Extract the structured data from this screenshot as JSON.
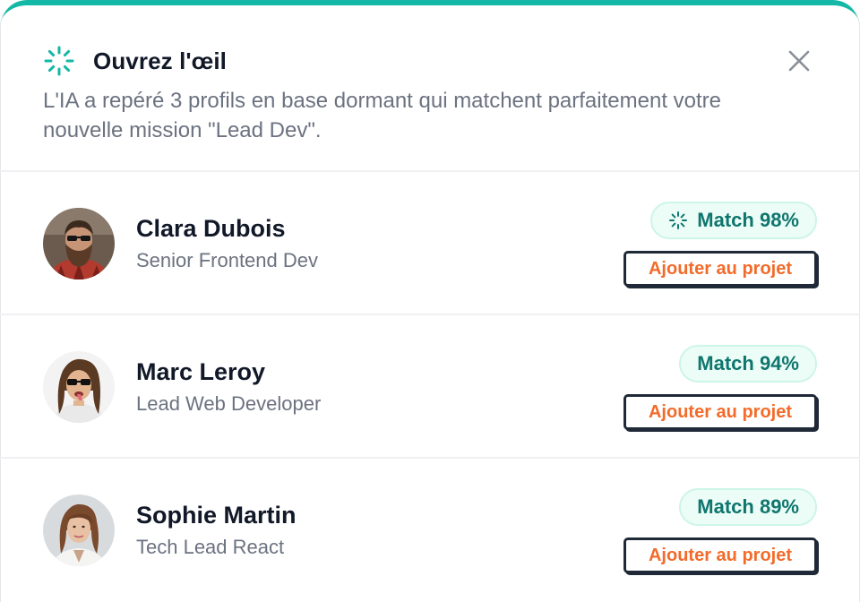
{
  "header": {
    "title": "Ouvrez l'œil",
    "subtitle": "L'IA a repéré 3 profils en base dormant qui matchent parfaitement votre nouvelle mission \"Lead Dev\"."
  },
  "colors": {
    "accent": "#14b8a6",
    "match_text": "#0f766e",
    "match_bg": "#ecfdf7",
    "action_text": "#f26b2a"
  },
  "icons": {
    "title_icon": "sparkle-loader-icon",
    "close_icon": "close-icon",
    "badge_icon": "sparkle-loader-icon"
  },
  "profiles": [
    {
      "name": "Clara Dubois",
      "role": "Senior Frontend Dev",
      "match": "Match 98%",
      "match_icon": true,
      "action": "Ajouter au projet"
    },
    {
      "name": "Marc Leroy",
      "role": "Lead Web Developer",
      "match": "Match 94%",
      "match_icon": false,
      "action": "Ajouter au projet"
    },
    {
      "name": "Sophie Martin",
      "role": "Tech Lead React",
      "match": "Match 89%",
      "match_icon": false,
      "action": "Ajouter au projet"
    }
  ]
}
